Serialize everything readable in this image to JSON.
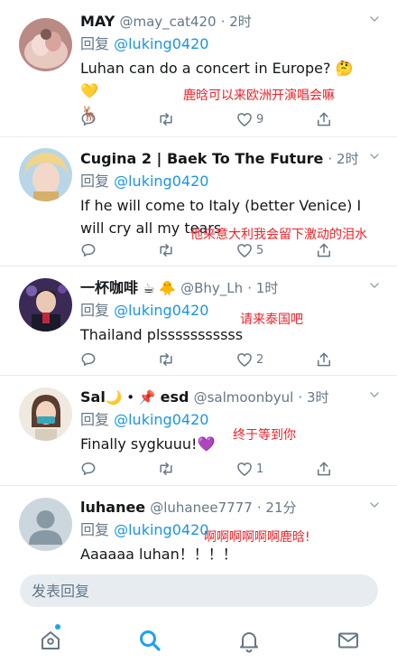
{
  "colors": {
    "link": "#1b95e0",
    "accent": "#1da1f2",
    "annotation": "#e8242b",
    "muted": "#657786",
    "divider": "#e6ecf0"
  },
  "reply_prefix": "回复",
  "tweets": [
    {
      "name": "MAY",
      "handle": "@may_cat420",
      "time": "· 2时",
      "reply_to": "@luking0420",
      "text": "Luhan can do a concert in Europe? 🤔 💛",
      "text2": "🦌",
      "annotation": "鹿晗可以来欧洲开演唱会嘛",
      "reply_count": "",
      "retweet_count": "",
      "like_count": "9"
    },
    {
      "name": "Cugina 2 | Baek To The Future",
      "handle": "",
      "time": "· 2时",
      "reply_to": "@luking0420",
      "text": "If he will come to Italy (better Venice) I will cry all my tears",
      "annotation": "他来意大利我会留下激动的泪水",
      "reply_count": "",
      "retweet_count": "",
      "like_count": "5"
    },
    {
      "name": "一杯咖啡",
      "name_emoji": "☕ 🐥",
      "handle": "@Bhy_Lh",
      "time": "· 1时",
      "reply_to": "@luking0420",
      "text": "Thailand plsssssssssss",
      "annotation": "请来泰国吧",
      "reply_count": "",
      "retweet_count": "",
      "like_count": "2"
    },
    {
      "name": "Sal",
      "name_emoji": "🌙 • 📌",
      "name2": "esd",
      "handle": "@salmoonbyul",
      "time": "· 3时",
      "reply_to": "@luking0420",
      "text": "Finally sygkuuu!💜",
      "annotation": "终于等到你",
      "reply_count": "",
      "retweet_count": "",
      "like_count": "1"
    },
    {
      "name": "luhanee",
      "handle": "@luhanee7777",
      "time": "· 21分",
      "reply_to": "@luking0420",
      "text": "Aaaaaa luhan！！！！",
      "annotation": "啊啊啊啊啊啊鹿晗!"
    }
  ],
  "compose": {
    "placeholder": "发表回复"
  },
  "tabbar": {
    "items": [
      "home-icon",
      "search-icon",
      "notifications-icon",
      "messages-icon"
    ],
    "active": "search-icon"
  }
}
